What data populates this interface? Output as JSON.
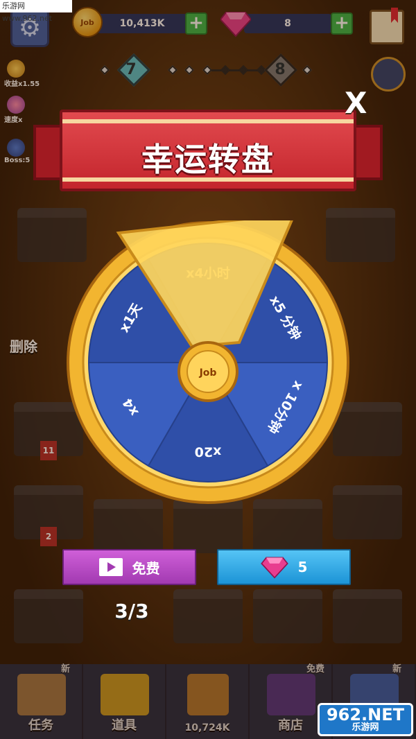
{
  "watermark_top": "乐游网 www.962.net",
  "watermark_bottom": {
    "brand": "962.NET",
    "sub": "乐游网"
  },
  "header": {
    "coins": "10,413K",
    "gems": "8",
    "coin_label": "Job"
  },
  "stats": [
    {
      "label": "收益x1.55",
      "icon": "coin-up-icon"
    },
    {
      "label": "速度x",
      "icon": "speed-icon"
    },
    {
      "label": "Boss:5",
      "icon": "boss-shield-icon"
    }
  ],
  "progress": {
    "current_level": "7",
    "next_level": "8"
  },
  "background_labels": {
    "delete": "删除",
    "badge1": "11",
    "badge2": "2"
  },
  "modal": {
    "title": "幸运转盘",
    "close": "X",
    "segments": [
      "x4小时",
      "x5 分钟",
      "x 10分钟",
      "x20",
      "x4",
      "x1天"
    ],
    "center_label": "Job"
  },
  "buttons": {
    "free_label": "免费",
    "gem_cost": "5"
  },
  "spins_remaining": "3/3",
  "nav": {
    "items": [
      {
        "label": "任务",
        "badge": "新"
      },
      {
        "label": "道具",
        "badge": ""
      },
      {
        "label": "10,724K",
        "badge": ""
      },
      {
        "label": "商店",
        "badge": "免费"
      },
      {
        "label": "",
        "badge": "新"
      }
    ]
  },
  "colors": {
    "banner": "#d3343a",
    "wheel_rim": "#f2b530",
    "wheel_blue": "#3457b0",
    "free_btn": "#b849c4",
    "gem_btn": "#2aa6e4"
  }
}
